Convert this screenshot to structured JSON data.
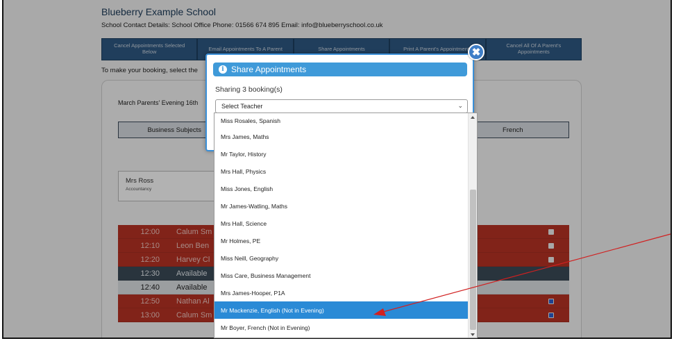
{
  "school": {
    "name": "Blueberry Example School",
    "contact": "School Contact Details: School Office   Phone: 01566 674 895   Email: info@blueberryschool.co.uk"
  },
  "toolbar": {
    "buttons": [
      "Cancel Appointments Selected Below",
      "Email Appointments To A Parent",
      "Share Appointments",
      "Print A Parent's Appointments",
      "Cancel All Of A Parent's Appointments"
    ]
  },
  "instruction": "To make your booking, select the",
  "evening": "March Parents' Evening 16th",
  "tabs": [
    "Business Subjects",
    "",
    "",
    "French"
  ],
  "teacher_card": {
    "name": "Mrs Ross",
    "subject": "Accountancy"
  },
  "slots": [
    {
      "time": "12:00",
      "name": "Calum Sm",
      "status": "booked"
    },
    {
      "time": "12:10",
      "name": "Leon Ben",
      "status": "booked"
    },
    {
      "time": "12:20",
      "name": "Harvey Cl",
      "status": "booked"
    },
    {
      "time": "12:30",
      "name": "Available",
      "status": "available"
    },
    {
      "time": "12:40",
      "name": "Available",
      "status": "available-light"
    },
    {
      "time": "12:50",
      "name": "Nathan Al",
      "status": "booked-selected"
    },
    {
      "time": "13:00",
      "name": "Calum Sm",
      "status": "booked-selected"
    }
  ],
  "modal": {
    "title": "Share Appointments",
    "sharing_text": "Sharing 3 booking(s)",
    "select_value": "Select Teacher",
    "close_icon": "close-icon"
  },
  "dropdown": {
    "options": [
      "Miss Rosales, Spanish",
      "Mrs James, Maths",
      "Mr Taylor, History",
      "Mrs Hall, Physics",
      "Miss Jones, English",
      "Mr James-Watling, Maths",
      "Mrs Hall, Science",
      "Mr Holmes, PE",
      "Miss Neill, Geography",
      "Miss Care, Business Management",
      "Mrs James-Hooper, P1A",
      "Mr Mackenzie, English (Not in Evening)",
      "Mr Boyer, French (Not in Evening)"
    ],
    "highlighted_index": 11
  },
  "colors": {
    "accent": "#3f9ad9",
    "highlight": "#2a8ad6",
    "booked": "#b93324",
    "available": "#3c4b58",
    "annotation_arrow": "#d12020"
  }
}
